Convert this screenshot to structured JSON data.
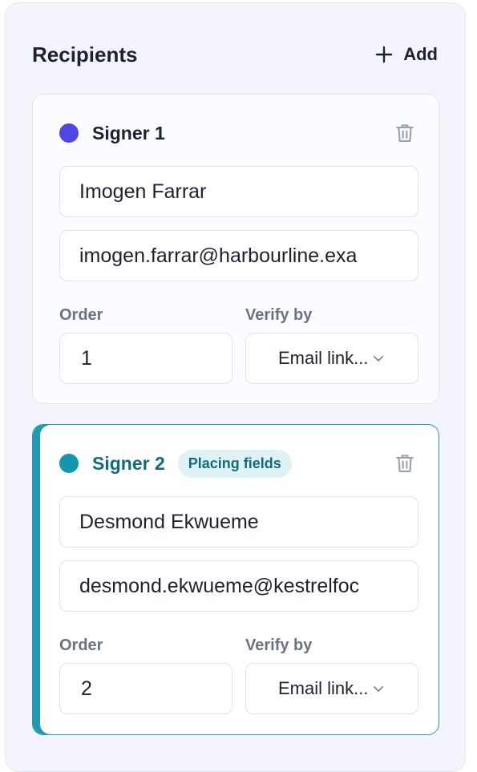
{
  "panel": {
    "title": "Recipients",
    "add_label": "Add"
  },
  "signers": [
    {
      "label": "Signer 1",
      "dot_color": "#5046e5",
      "name": "Imogen Farrar",
      "email": "imogen.farrar@harbourline.exa",
      "order_label": "Order",
      "order": "1",
      "verify_label": "Verify by",
      "verify": "Email link..."
    },
    {
      "label": "Signer 2",
      "dot_color": "#1597ab",
      "badge": "Placing fields",
      "name": "Desmond Ekwueme",
      "email": "desmond.ekwueme@kestrelfoc",
      "order_label": "Order",
      "order": "2",
      "verify_label": "Verify by",
      "verify": "Email link..."
    }
  ],
  "colors": {
    "active_accent": "#1f9aae",
    "panel_bg": "#f4f5fc"
  }
}
